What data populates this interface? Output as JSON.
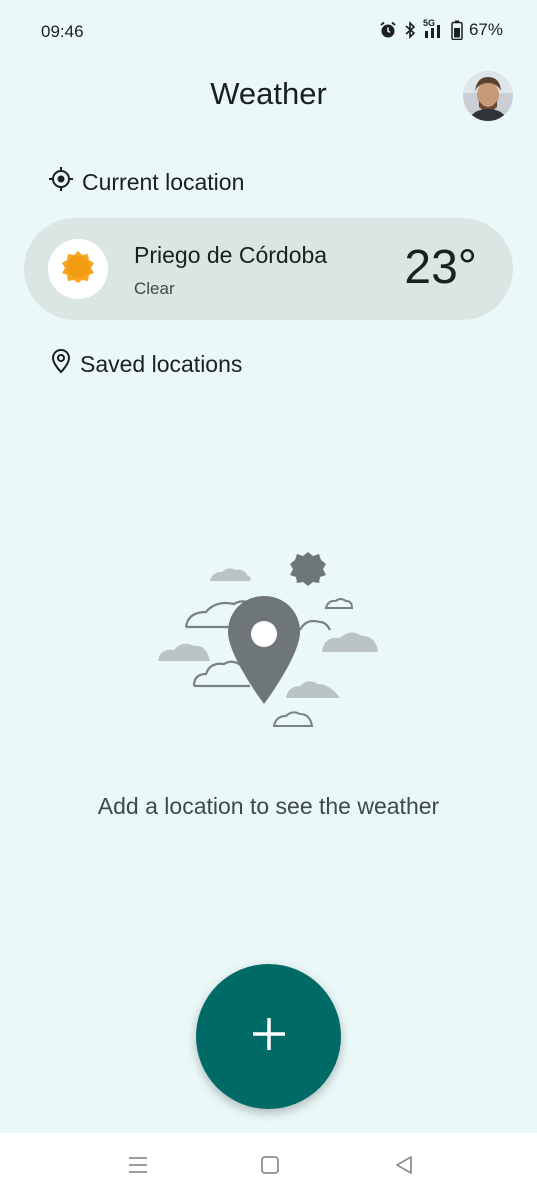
{
  "status_bar": {
    "time": "09:46",
    "network": "5G",
    "battery": "67%",
    "icons": [
      "alarm-icon",
      "bluetooth-icon",
      "signal-icon",
      "battery-icon"
    ]
  },
  "header": {
    "title": "Weather"
  },
  "current_location": {
    "section_label": "Current location",
    "city": "Priego de Córdoba",
    "condition": "Clear",
    "temperature": "23°",
    "weather_icon": "sun-icon"
  },
  "saved_locations": {
    "section_label": "Saved locations",
    "empty_message": "Add a location to see the weather"
  },
  "fab": {
    "icon": "plus-icon"
  },
  "colors": {
    "background": "#eaf8f8",
    "card": "#dbe5e4",
    "fab": "#006a66",
    "sun": "#f5a623"
  }
}
